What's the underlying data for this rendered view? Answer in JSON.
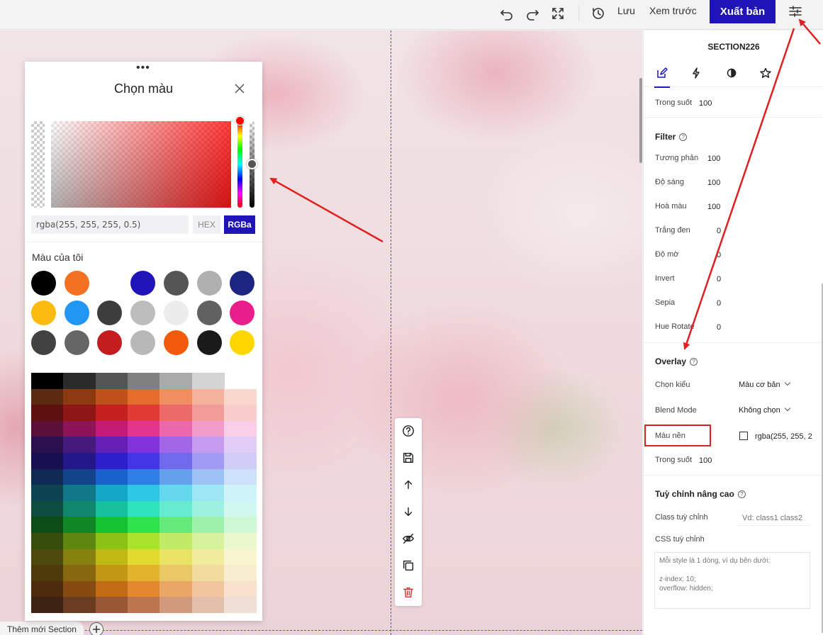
{
  "topbar": {
    "save_label": "Lưu",
    "preview_label": "Xem trước",
    "publish_label": "Xuất bản"
  },
  "canvas": {
    "add_section_label": "Thêm mới Section"
  },
  "picker": {
    "title": "Chọn màu",
    "color_value": "rgba(255, 255, 255, 0.5)",
    "hue_color": "#ff0000",
    "alpha": 0.5,
    "mode_hex": "HEX",
    "mode_rgba": "RGBa",
    "active_mode": "RGBa",
    "my_colors_label": "Màu của tôi",
    "my_colors": [
      [
        "#000000",
        "#f37121",
        "",
        "#1f14b8",
        "#555555",
        "#b0b0b0",
        "#1c2582"
      ],
      [
        "#fbbc0f",
        "#2196f3",
        "#3d3d3d",
        "#bdbdbd",
        "#ececec",
        "#616161",
        "#e91e8c"
      ],
      [
        "#424242",
        "#666666",
        "#c31d20",
        "#b8b8b8",
        "#f45a0c",
        "#1a1a1a",
        "#ffd600"
      ]
    ],
    "palette": [
      [
        "#000000",
        "#2b2b2b",
        "#555555",
        "#808080",
        "#aaaaaa",
        "#d4d4d4",
        ""
      ],
      [
        "#5c2a10",
        "#8d3a12",
        "#c0501c",
        "#e66c2c",
        "#f08e62",
        "#f4b29a",
        "#f9d7cc"
      ],
      [
        "#5e1010",
        "#8e1616",
        "#c4201d",
        "#e23a35",
        "#ec6b68",
        "#f29c99",
        "#f8cdcb"
      ],
      [
        "#5c0f3a",
        "#8d1456",
        "#c51a78",
        "#e2338f",
        "#ec68ad",
        "#f29ccb",
        "#f8cde5"
      ],
      [
        "#2b0f4f",
        "#441a7c",
        "#6420b4",
        "#8033da",
        "#a267e6",
        "#c59cef",
        "#e2cdf7"
      ],
      [
        "#180f52",
        "#231789",
        "#2b20cb",
        "#4236e6",
        "#7169ed",
        "#a19cf3",
        "#d0cdf9"
      ],
      [
        "#0e2a52",
        "#13448a",
        "#1860cc",
        "#2f7ee6",
        "#65a0ed",
        "#9bc2f3",
        "#cde0f9"
      ],
      [
        "#0c4452",
        "#107888",
        "#15a8c6",
        "#2ec8e6",
        "#66d8ed",
        "#9de6f3",
        "#cef3f9"
      ],
      [
        "#0c4d3f",
        "#10876c",
        "#15c29d",
        "#2ee3bb",
        "#66ead0",
        "#9df1e1",
        "#cef8f0"
      ],
      [
        "#0c4d17",
        "#108724",
        "#15c232",
        "#2ee34c",
        "#66ea7c",
        "#9df1ab",
        "#cef8d5"
      ],
      [
        "#364d0c",
        "#5e8710",
        "#8cc215",
        "#a9e32e",
        "#c1ea66",
        "#d7f19d",
        "#ebf8ce"
      ],
      [
        "#4d4a0c",
        "#878110",
        "#c2b915",
        "#e3da2e",
        "#eae466",
        "#f1ed9d",
        "#f8f6ce"
      ],
      [
        "#4d3b0c",
        "#876710",
        "#c29715",
        "#e3b32e",
        "#eac866",
        "#f1db9d",
        "#f8edce"
      ],
      [
        "#4d2b0c",
        "#874a10",
        "#c26b15",
        "#e3882e",
        "#eaa666",
        "#f1c59d",
        "#f8e2ce"
      ],
      [
        "#3e2314",
        "#6a3d22",
        "#995833",
        "#bd7550",
        "#d19a7d",
        "#e2bfab",
        "#f0dfd5"
      ]
    ]
  },
  "rpanel": {
    "title": "SECTION226",
    "tabs": [
      "edit",
      "actions",
      "effects",
      "favorite"
    ],
    "opacity_label": "Trong suốt",
    "opacity_value": "100",
    "filter": {
      "title": "Filter",
      "rows": [
        {
          "label": "Tương phản",
          "value": "100"
        },
        {
          "label": "Độ sáng",
          "value": "100"
        },
        {
          "label": "Hoà màu",
          "value": "100"
        },
        {
          "label": "Trắng đen",
          "value": "0"
        },
        {
          "label": "Độ mờ",
          "value": "0"
        },
        {
          "label": "Invert",
          "value": "0"
        },
        {
          "label": "Sepia",
          "value": "0"
        },
        {
          "label": "Hue Rotate",
          "value": "0"
        }
      ]
    },
    "overlay": {
      "title": "Overlay",
      "type_label": "Chọn kiểu",
      "type_value": "Màu cơ bản",
      "blend_label": "Blend Mode",
      "blend_value": "Không chọn",
      "bg_label": "Màu nền",
      "bg_value": "rgba(255, 255, 2",
      "opacity_label": "Trong suốt",
      "opacity_value": "100"
    },
    "advanced": {
      "title": "Tuỳ chỉnh nâng cao",
      "class_label": "Class tuỳ chỉnh",
      "class_placeholder": "Vd: class1 class2",
      "css_label": "CSS tuỳ chỉnh",
      "css_placeholder": "Mỗi style là 1 dòng, ví dụ bên dưới:\n\nz-index: 10;\noverflow: hidden;"
    }
  },
  "colors": {
    "accent": "#1f14b8",
    "annotation": "#e02020"
  }
}
